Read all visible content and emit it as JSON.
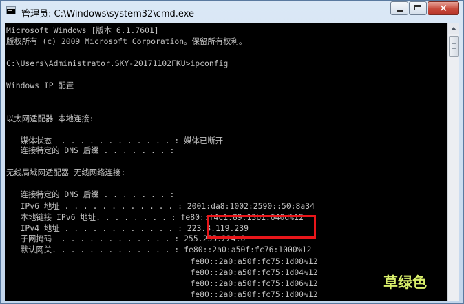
{
  "window": {
    "title": "管理员: C:\\Windows\\system32\\cmd.exe",
    "close_glyph": "✕",
    "controls": [
      "minimize-icon",
      "maximize-icon",
      "close-icon"
    ]
  },
  "console_lines": [
    "Microsoft Windows [版本 6.1.7601]",
    "版权所有 (c) 2009 Microsoft Corporation。保留所有权利。",
    "C:\\Users\\Administrator.SKY-20171102FKU>ipconfig",
    "Windows IP 配置",
    "以太网适配器 本地连接:",
    "   媒体状态  . . . . . . . . . . . . : 媒体已断开",
    "   连接特定的 DNS 后缀 . . . . . . . :",
    "无线局域网适配器 无线网络连接:",
    "   连接特定的 DNS 后缀 . . . . . . . :",
    "   IPv6 地址 . . . . . . . . . . . . : 2001:da8:1002:2590::50:8a34",
    "   本地链接 IPv6 地址. . . . . . . . : fe80::f4c1:89:13b1:640d%12",
    "   IPv4 地址 . . . . . . . . . . . . : 223.3.119.239",
    "   子网掩码  . . . . . . . . . . . . : 255.255.224.0",
    "   默认网关. . . . . . . . . . . . . : fe80::2a0:a50f:fc76:1000%12",
    "                                       fe80::2a0:a50f:fc75:1d08%12",
    "                                       fe80::2a0:a50f:fc75:1d04%12",
    "                                       fe80::2a0:a50f:fc75:1d06%12",
    "                                       fe80::2a0:a50f:fc75:1d00%12"
  ],
  "annotation": {
    "highlight_color": "#e8161a",
    "watermark_text": "草绿色",
    "watermark_color": "#d9ef6b"
  },
  "colors": {
    "console_bg": "#000000",
    "console_text": "#c0c0c0"
  }
}
